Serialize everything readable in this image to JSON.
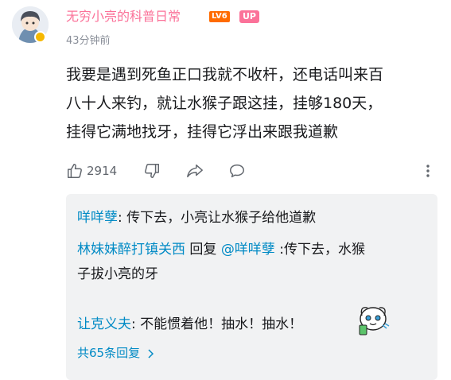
{
  "comment": {
    "username": "无穷小亮的科普日常",
    "level_badge": "LV6",
    "up_badge": "UP",
    "time": "43分钟前",
    "content_lines": [
      "我要是遇到死鱼正口我就不收杆，还电话叫来百",
      "八十人来钓，就让水猴子跟这挂，挂够180天，",
      "挂得它满地找牙，挂得它浮出来跟我道歉"
    ],
    "like_count": "2914"
  },
  "replies": [
    {
      "user": "咩咩孽",
      "text": ": 传下去，小亮让水猴子给他道歉"
    },
    {
      "user": "林妹妹醉打镇关西",
      "reply_word": " 回复 ",
      "mention": "@咩咩孽",
      "text_line1": " :传下去，水猴",
      "text_line2": "子拔小亮的牙"
    },
    {
      "user": "让克义夫",
      "text": ": 不能惯着他！抽水！抽水！"
    }
  ],
  "reply_more": "共65条回复",
  "colors": {
    "username": "#fb7299",
    "level_badge": "#ff6b00",
    "reply_user": "#008ac5",
    "reply_bg": "#f1f2f3"
  },
  "icons": [
    "thumbs-up-icon",
    "thumbs-down-icon",
    "share-icon",
    "comment-icon",
    "more-vertical-icon",
    "chevron-right-icon"
  ]
}
